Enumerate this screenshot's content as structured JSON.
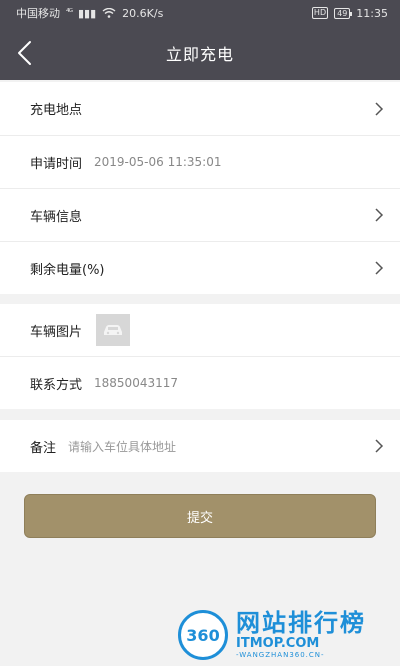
{
  "status_bar": {
    "carrier": "中国移动",
    "signal": "⁴ᴳ",
    "speed": "20.6K/s",
    "hd": "HD",
    "battery": "49",
    "time": "11:35"
  },
  "header": {
    "title": "立即充电"
  },
  "form": {
    "location_label": "充电地点",
    "time_label": "申请时间",
    "time_value": "2019-05-06 11:35:01",
    "vehicle_label": "车辆信息",
    "battery_label": "剩余电量(%)",
    "image_label": "车辆图片",
    "contact_label": "联系方式",
    "contact_value": "18850043117",
    "remark_label": "备注",
    "remark_placeholder": "请输入车位具体地址"
  },
  "submit_label": "提交",
  "watermark": {
    "logo_text": "360",
    "cn_text": "网站排行榜",
    "en_text": "ITMOP.COM",
    "en_sub": "-WANGZHAN360.CN-"
  },
  "colors": {
    "bar": "#4b4a52",
    "accent": "#a2916a",
    "watermark": "#1e8fd8"
  },
  "icons": [
    "back-arrow-icon",
    "chevron-right-icon",
    "car-icon",
    "wifi-icon",
    "battery-icon"
  ]
}
